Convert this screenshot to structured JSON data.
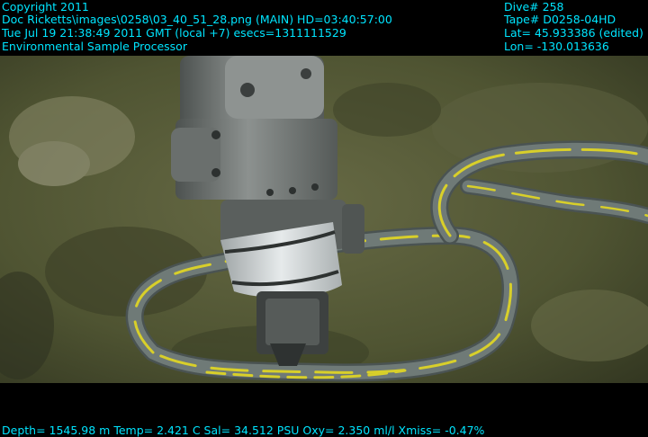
{
  "overlay": {
    "copyright": "Copyright 2011",
    "image_info": "Doc Ricketts\\images\\0258\\03_40_51_28.png (MAIN)  HD=03:40:57:00",
    "datetime": "Tue Jul 19 21:38:49 2011 GMT (local +7)  esecs=1311111529",
    "instrument": "Environmental Sample Processor",
    "dive": "Dive# 258",
    "tape": "Tape# D0258-04HD",
    "lat": "Lat= 45.933386 (edited)",
    "lon": "Lon= -130.013636",
    "sensors": "Depth= 1545.98 m  Temp= 2.421 C  Sal= 34.512 PSU  Oxy= 2.350 ml/l  Xmiss= -0.47%"
  },
  "colors": {
    "overlay_text": "#00e5ff",
    "seafloor": "#4f5432",
    "hose_gray": "#6f7a77",
    "hose_stripe": "#d8cf2a",
    "arm_metal": "#7d8280"
  },
  "scene": {
    "subject": "rov-manipulator-arm-icon",
    "object": "coiled-hose-icon"
  }
}
